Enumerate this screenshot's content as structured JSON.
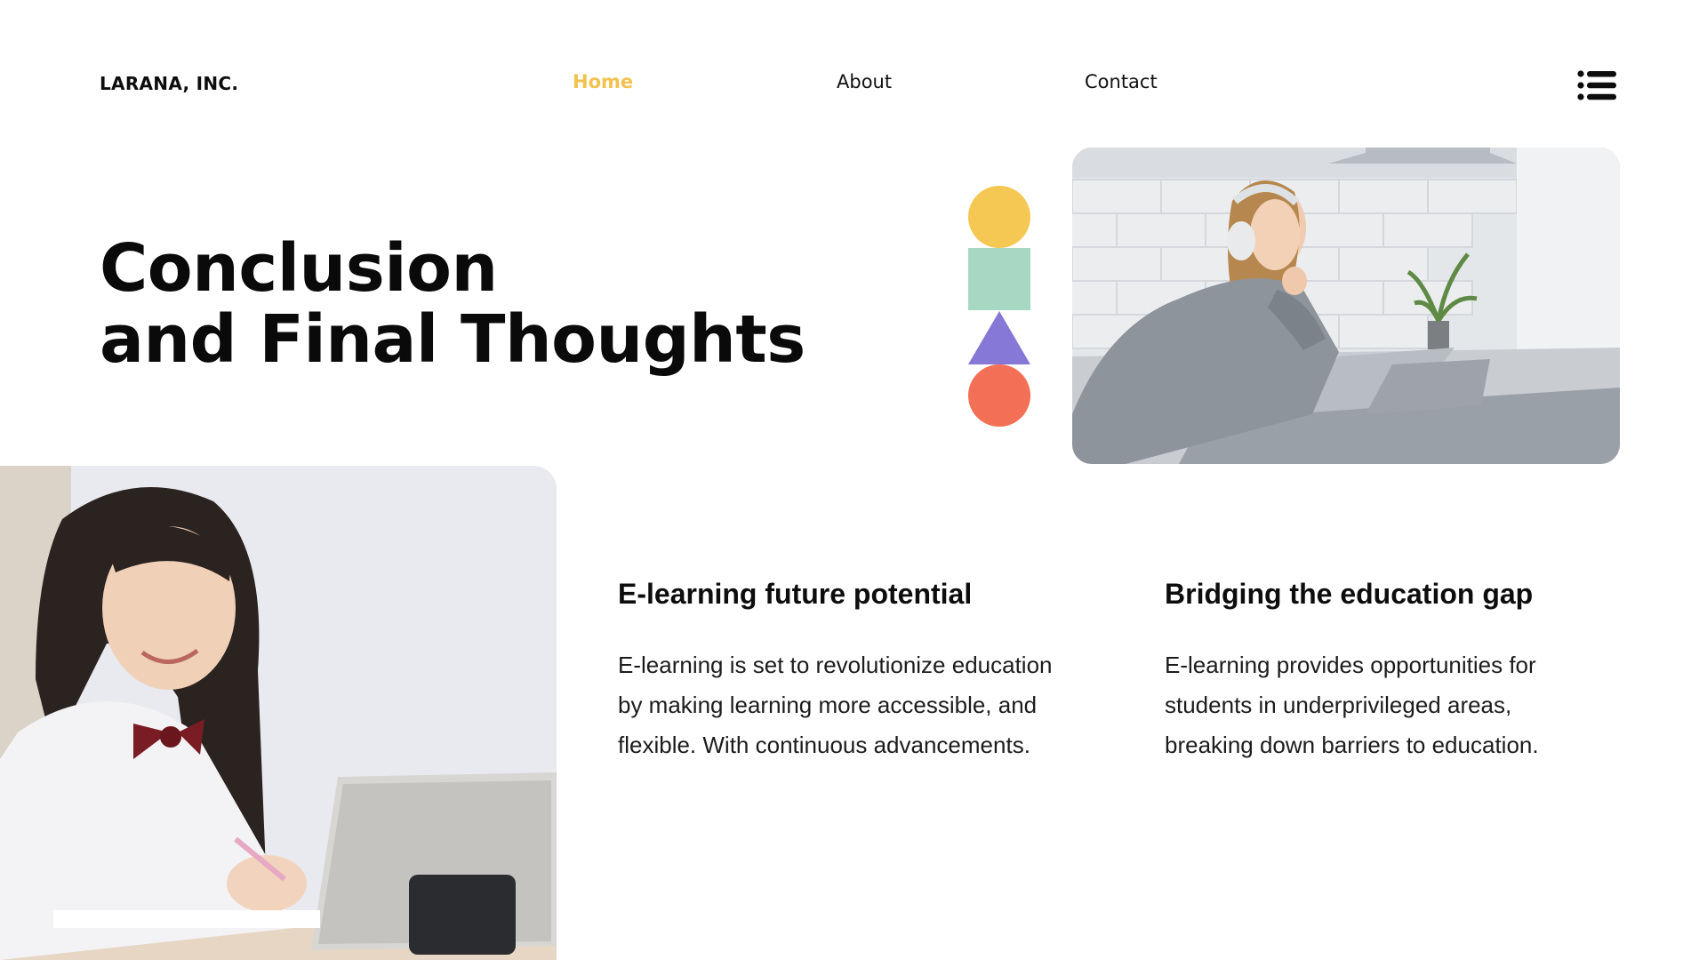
{
  "brand": {
    "name": "LARANA, INC."
  },
  "nav": {
    "items": [
      {
        "label": "Home",
        "active": true
      },
      {
        "label": "About",
        "active": false
      },
      {
        "label": "Contact",
        "active": false
      }
    ],
    "menu_icon": "list-menu-icon"
  },
  "hero": {
    "title_lines": [
      "Conclusion",
      "and Final Thoughts"
    ]
  },
  "decor": {
    "shapes": [
      {
        "shape": "circle",
        "color": "#f5c853"
      },
      {
        "shape": "square",
        "color": "#a6d8c4"
      },
      {
        "shape": "triangle",
        "color": "#8678d6"
      },
      {
        "shape": "circle",
        "color": "#f36f55"
      }
    ]
  },
  "images": {
    "top": "photo-woman-headphones-laptop",
    "left": "photo-student-writing-tablet"
  },
  "columns": [
    {
      "heading": "E-learning future potential",
      "body_lines": [
        "E-learning is set to revolutionize education",
        "by making learning more accessible, and",
        "flexible. With continuous advancements."
      ]
    },
    {
      "heading": "Bridging the education gap",
      "body_lines": [
        "E-learning provides opportunities for",
        "students in underprivileged areas,",
        "breaking down barriers to education."
      ]
    }
  ],
  "colors": {
    "accent": "#f2c14e",
    "text": "#0d0d0d"
  }
}
